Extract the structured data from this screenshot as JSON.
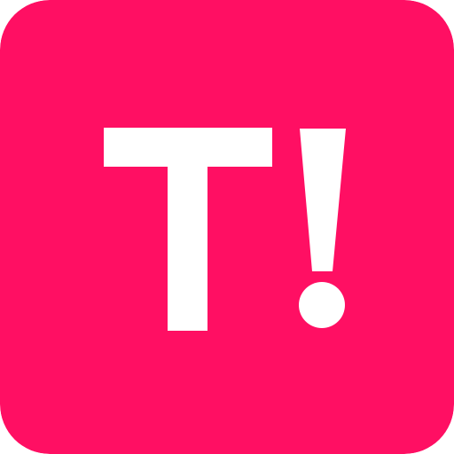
{
  "logo": {
    "text": "T!",
    "background_color": "#FF0F63",
    "glyph_color": "#FFFFFF"
  }
}
